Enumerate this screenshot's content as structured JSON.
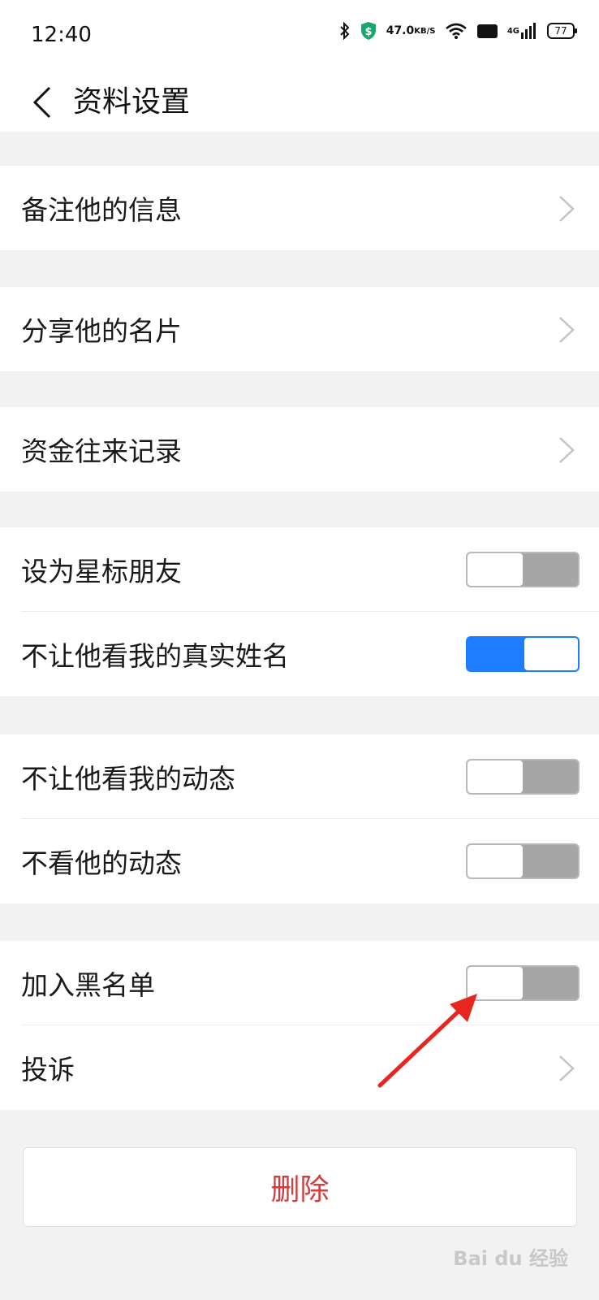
{
  "status_bar": {
    "time": "12:40",
    "net_speed_value": "47.0",
    "net_speed_unit": "KB/S",
    "network_label": "4G",
    "hd_label": "HD",
    "battery": "77",
    "icons": [
      "bluetooth-icon",
      "shield-icon",
      "wifi-icon",
      "hd-icon",
      "signal-icon",
      "battery-icon"
    ]
  },
  "header": {
    "title": "资料设置"
  },
  "groups": [
    {
      "items": [
        {
          "label": "备注他的信息",
          "type": "link"
        }
      ]
    },
    {
      "items": [
        {
          "label": "分享他的名片",
          "type": "link"
        }
      ]
    },
    {
      "items": [
        {
          "label": "资金往来记录",
          "type": "link"
        }
      ]
    },
    {
      "items": [
        {
          "label": "设为星标朋友",
          "type": "toggle",
          "on": false
        },
        {
          "label": "不让他看我的真实姓名",
          "type": "toggle",
          "on": true
        }
      ]
    },
    {
      "items": [
        {
          "label": "不让他看我的动态",
          "type": "toggle",
          "on": false
        },
        {
          "label": "不看他的动态",
          "type": "toggle",
          "on": false
        }
      ]
    },
    {
      "items": [
        {
          "label": "加入黑名单",
          "type": "toggle",
          "on": false
        },
        {
          "label": "投诉",
          "type": "link"
        }
      ]
    }
  ],
  "delete_button": {
    "label": "删除"
  },
  "watermark": {
    "text": "Bai du 经验"
  },
  "colors": {
    "accent": "#1e7cff",
    "toggle_off": "#a6a6a6",
    "danger": "#d43c3c",
    "annotation_arrow": "#e8261f",
    "background": "#f2f2f2"
  }
}
